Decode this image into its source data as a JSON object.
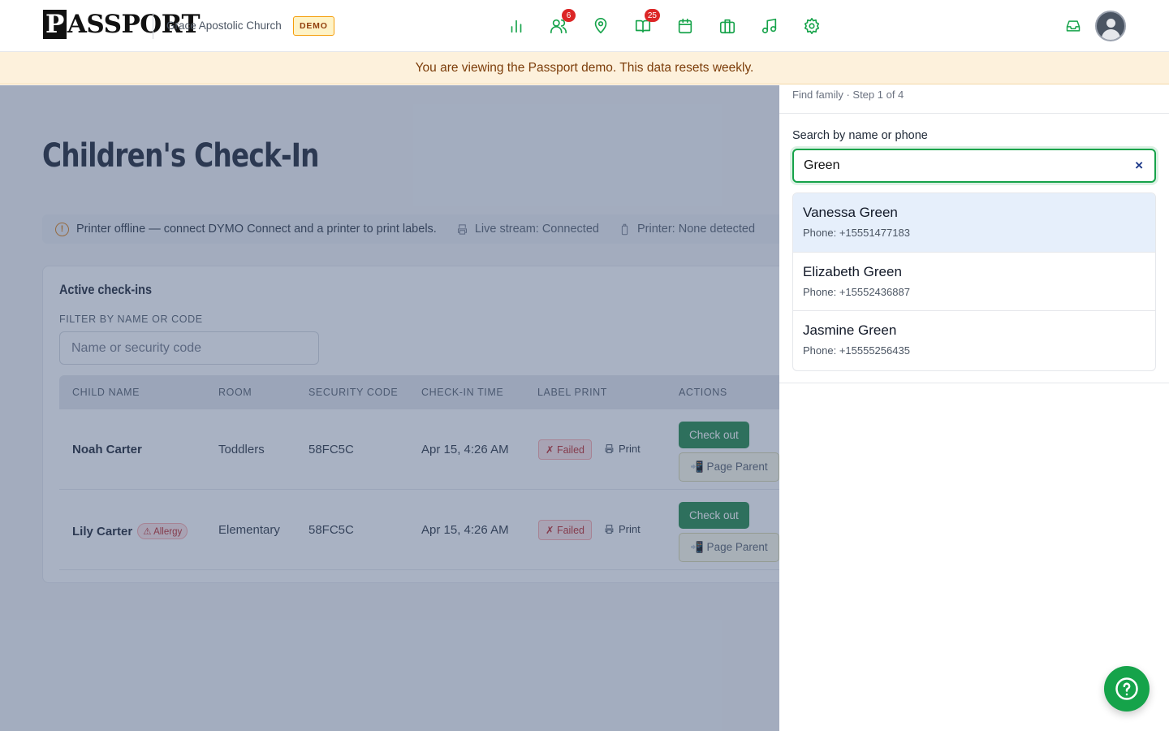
{
  "brand": {
    "logo_text": "ASSPORT",
    "logo_initial": "P",
    "church": "Grace Apostolic Church",
    "demo_tag": "DEMO"
  },
  "nav": {
    "items": [
      {
        "name": "reports-icon",
        "badge": ""
      },
      {
        "name": "people-icon",
        "badge": "6"
      },
      {
        "name": "location-icon",
        "badge": ""
      },
      {
        "name": "book-icon",
        "badge": "25"
      },
      {
        "name": "calendar-icon",
        "badge": ""
      },
      {
        "name": "briefcase-icon",
        "badge": ""
      },
      {
        "name": "music-icon",
        "badge": ""
      },
      {
        "name": "settings-icon",
        "badge": ""
      }
    ]
  },
  "banner": {
    "text": "You are viewing the Passport demo. This data resets weekly."
  },
  "page": {
    "title": "Children's Check-In",
    "status": {
      "warning": "Printer offline — connect DYMO Connect and a printer to print labels.",
      "stream": "Live stream: Connected",
      "printer": "Printer: None detected"
    },
    "card": {
      "title": "Active check-ins",
      "filter_label": "FILTER BY NAME OR CODE",
      "filter_placeholder": "Name or security code",
      "columns": [
        "CHILD NAME",
        "ROOM",
        "SECURITY CODE",
        "CHECK-IN TIME",
        "LABEL PRINT",
        "ACTIONS"
      ],
      "rows": [
        {
          "name": "Noah Carter",
          "allergy": "",
          "room": "Toddlers",
          "code": "58FC5C",
          "time": "Apr 15, 4:26 AM",
          "label_status": "✗ Failed",
          "print": "Print",
          "checkout": "Check out",
          "page_parent": "📲 Page Parent"
        },
        {
          "name": "Lily Carter",
          "allergy": "⚠ Allergy",
          "room": "Elementary",
          "code": "58FC5C",
          "time": "Apr 15, 4:26 AM",
          "label_status": "✗ Failed",
          "print": "Print",
          "checkout": "Check out",
          "page_parent": "📲 Page Parent"
        }
      ]
    }
  },
  "panel": {
    "step": "Find family · Step 1 of 4",
    "search_label": "Search by name or phone",
    "search_value": "Green",
    "clear_icon": "×",
    "results": [
      {
        "name": "Vanessa Green",
        "phone": "Phone: +15551477183"
      },
      {
        "name": "Elizabeth Green",
        "phone": "Phone: +15552436887"
      },
      {
        "name": "Jasmine Green",
        "phone": "Phone: +15555256435"
      }
    ]
  },
  "colors": {
    "accent": "#16a34a",
    "danger": "#dc2626",
    "banner_bg": "#fdf1dc"
  }
}
